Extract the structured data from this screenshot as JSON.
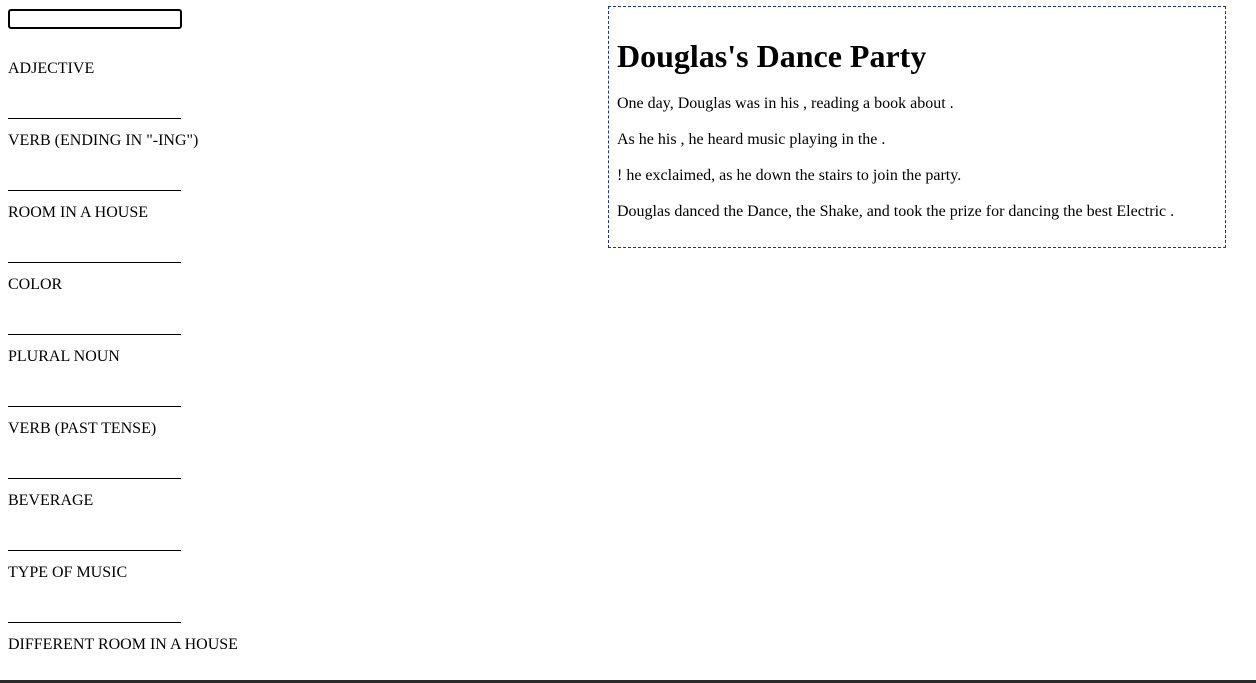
{
  "form": {
    "fields": [
      {
        "label": "ADJECTIVE"
      },
      {
        "label": "VERB (ENDING IN \"-ING\")"
      },
      {
        "label": "ROOM IN A HOUSE"
      },
      {
        "label": "COLOR"
      },
      {
        "label": "PLURAL NOUN"
      },
      {
        "label": "VERB (PAST TENSE)"
      },
      {
        "label": "BEVERAGE"
      },
      {
        "label": "TYPE OF MUSIC"
      },
      {
        "label": "DIFFERENT ROOM IN A HOUSE"
      }
    ]
  },
  "story": {
    "title": "Douglas's Dance Party",
    "lines": [
      "One day, Douglas was in his , reading a book about .",
      "As he his , he heard music playing in the .",
      "! he exclaimed, as he down the stairs to join the party.",
      "Douglas danced the Dance, the Shake, and took the prize for dancing the best Electric ."
    ]
  },
  "colors": {
    "story_border": "#1a2fa3",
    "bottom_bar": "#2b2b2b"
  }
}
